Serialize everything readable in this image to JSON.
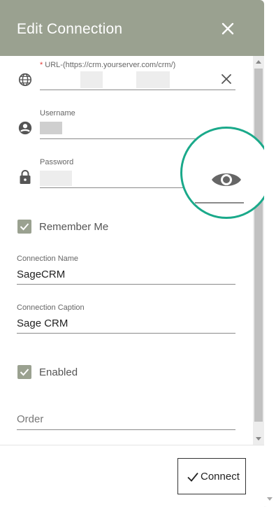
{
  "dialog": {
    "title": "Edit Connection",
    "close_icon": "close-icon"
  },
  "fields": {
    "url": {
      "required_mark": "*",
      "label": "URL-(https://crm.yourserver.com/crm/)",
      "icon": "globe-icon",
      "clear_icon": "clear-icon"
    },
    "username": {
      "label": "Username",
      "icon": "account-circle-icon"
    },
    "password": {
      "label": "Password",
      "icon": "lock-icon",
      "toggle_icon": "eye-icon"
    },
    "remember_me": {
      "label": "Remember Me",
      "checked": true
    },
    "connection_name": {
      "label": "Connection Name",
      "value": "SageCRM"
    },
    "connection_caption": {
      "label": "Connection Caption",
      "value": "Sage CRM"
    },
    "enabled": {
      "label": "Enabled",
      "checked": true
    },
    "order": {
      "placeholder": "Order"
    }
  },
  "footer": {
    "connect_label": "Connect",
    "connect_icon": "checkmark-icon"
  },
  "colors": {
    "header": "#9aa190",
    "checkbox": "#9aa190",
    "highlight_circle": "#1aa98a"
  }
}
